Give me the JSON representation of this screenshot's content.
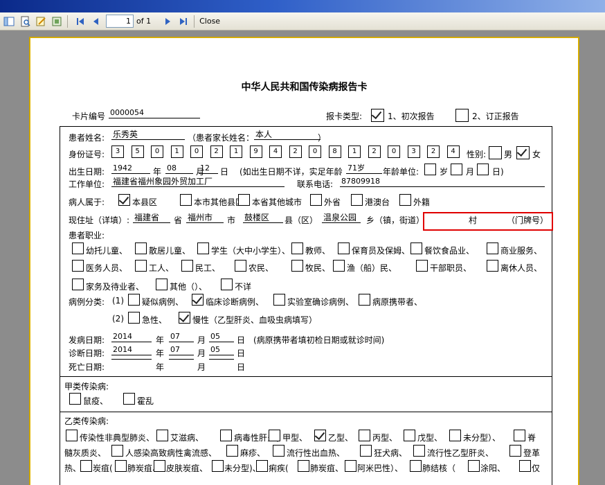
{
  "toolbar": {
    "page_value": "1",
    "page_of": "of 1",
    "close_label": "Close"
  },
  "card": {
    "title": "中华人民共和国传染病报告卡",
    "card_no_label": "卡片编号",
    "card_no_value": "0000054",
    "report_type_label": "报卡类型:",
    "report_type_opt1": "1、初次报告",
    "report_type_opt2": "2、订正报告"
  },
  "patient": {
    "name_label": "患者姓名:",
    "name_value": "乐秀英",
    "guardian_open": "（患者家长姓名：",
    "guardian_value": "本人",
    "guardian_close": "）",
    "id_label": "身份证号:",
    "id_digits": [
      "3",
      "5",
      "0",
      "1",
      "0",
      "2",
      "1",
      "9",
      "4",
      "2",
      "0",
      "8",
      "1",
      "2",
      "0",
      "3",
      "2",
      "4"
    ],
    "sex_label": "性别:",
    "sex_male": "男",
    "sex_female": "女",
    "birth_label": "出生日期:",
    "birth_year": "1942",
    "year_unit": "年",
    "birth_month": "08",
    "month_unit": "月",
    "birth_day": "12",
    "day_unit": "日",
    "age_note": "(如出生日期不详，实足年龄",
    "age_value": "71岁",
    "age_unit_label": "年龄单位:",
    "age_unit_year": "岁",
    "age_unit_month": "月",
    "age_unit_day": "日)",
    "work_label": "工作单位:",
    "work_value": "福建省福州象园外贸加工厂",
    "phone_label": "联系电话:",
    "phone_value": "87809918",
    "belong_label": "病人属于:",
    "belong_opts": [
      "本县区",
      "本市其他县区",
      "本省其他城市",
      "外省",
      "港澳台",
      "外籍"
    ],
    "addr_label": "现住址（详填）:",
    "addr_province": "福建省",
    "addr_province_unit": "省",
    "addr_city": "福州市",
    "addr_city_unit": "市",
    "addr_county": "鼓楼区",
    "addr_county_unit": "县（区）",
    "addr_town": "温泉公园",
    "addr_town_unit": "乡（镇，街道）",
    "addr_village_unit": "村",
    "addr_house_unit": "（门牌号）",
    "occupation_label": "患者职业:",
    "occupations": [
      "幼托儿童、",
      "散居儿童、",
      "学生（大中小学生）、",
      "教师、",
      "保育员及保姆、",
      "餐饮食品业、",
      "商业服务、",
      "医务人员、",
      "工人、",
      "民工、",
      "农民、",
      "牧民、",
      "渔（船）民、",
      "干部职员、",
      "离休人员、",
      "家务及待业者、",
      "其他（）、",
      "不详"
    ],
    "case_class_label": "病例分类:",
    "case_1": "(1)",
    "case_opts1": [
      "疑似病例、",
      "临床诊断病例、",
      "实验室确诊病例、",
      "病原携带者、"
    ],
    "case_2": "(2)",
    "case_opts2": [
      "急性、",
      "慢性（乙型肝炎、血吸虫病填写）"
    ],
    "onset_label": "发病日期:",
    "onset_year": "2014",
    "onset_month": "07",
    "onset_day": "05",
    "onset_note": "(病原携带者填初检日期或就诊时间)",
    "diag_label": "诊断日期:",
    "diag_year": "2014",
    "diag_month": "07",
    "diag_day": "05",
    "death_label": "死亡日期:"
  },
  "class_a": {
    "label": "甲类传染病:",
    "items": [
      "鼠疫、",
      "霍乱"
    ]
  },
  "class_b": {
    "label": "乙类传染病:",
    "row1": [
      "传染性非典型肺炎、",
      "艾滋病、",
      "病毒性肝炎(",
      "甲型、",
      "乙型、",
      "丙型、",
      "戊型、",
      "未分型）、",
      "脊"
    ],
    "row2_prefix": "髓灰质炎、",
    "row2": [
      "人感染高致病性禽流感、",
      "麻疹、",
      "流行性出血热、",
      "狂犬病、",
      "流行性乙型肝炎、",
      "登革"
    ],
    "row3_prefix": "热、",
    "row3": [
      "炭疽(",
      "肺炭疽、",
      "皮肤炭疽、",
      "未分型)、",
      "痢疾(",
      "肺炭疽、",
      "阿米巴性）、",
      "肺结核（",
      "涂阳、",
      "仅"
    ]
  }
}
